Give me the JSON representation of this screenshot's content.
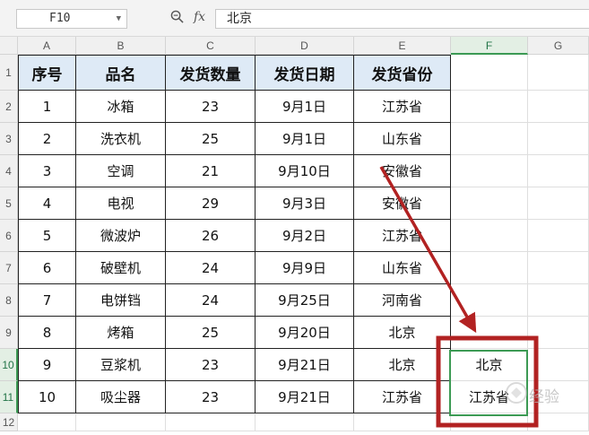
{
  "formula_bar": {
    "name_box": "F10",
    "fx_label": "fx",
    "formula_value": "北京"
  },
  "columns": [
    "A",
    "B",
    "C",
    "D",
    "E",
    "F",
    "G"
  ],
  "rows": [
    "1",
    "2",
    "3",
    "4",
    "5",
    "6",
    "7",
    "8",
    "9",
    "10",
    "11",
    "12"
  ],
  "table": {
    "headers": [
      "序号",
      "品名",
      "发货数量",
      "发货日期",
      "发货省份"
    ],
    "data": [
      [
        "1",
        "冰箱",
        "23",
        "9月1日",
        "江苏省"
      ],
      [
        "2",
        "洗衣机",
        "25",
        "9月1日",
        "山东省"
      ],
      [
        "3",
        "空调",
        "21",
        "9月10日",
        "安徽省"
      ],
      [
        "4",
        "电视",
        "29",
        "9月3日",
        "安徽省"
      ],
      [
        "5",
        "微波炉",
        "26",
        "9月2日",
        "江苏省"
      ],
      [
        "6",
        "破壁机",
        "24",
        "9月9日",
        "山东省"
      ],
      [
        "7",
        "电饼铛",
        "24",
        "9月25日",
        "河南省"
      ],
      [
        "8",
        "烤箱",
        "25",
        "9月20日",
        "北京"
      ],
      [
        "9",
        "豆浆机",
        "23",
        "9月21日",
        "北京"
      ],
      [
        "10",
        "吸尘器",
        "23",
        "9月21日",
        "江苏省"
      ]
    ]
  },
  "result_cells": {
    "F10": "北京",
    "F11": "江苏省"
  },
  "watermark": "经验",
  "colors": {
    "header_fill": "#deeaf6",
    "selection_green": "#3c9a54",
    "annotation_red": "#b22222"
  }
}
